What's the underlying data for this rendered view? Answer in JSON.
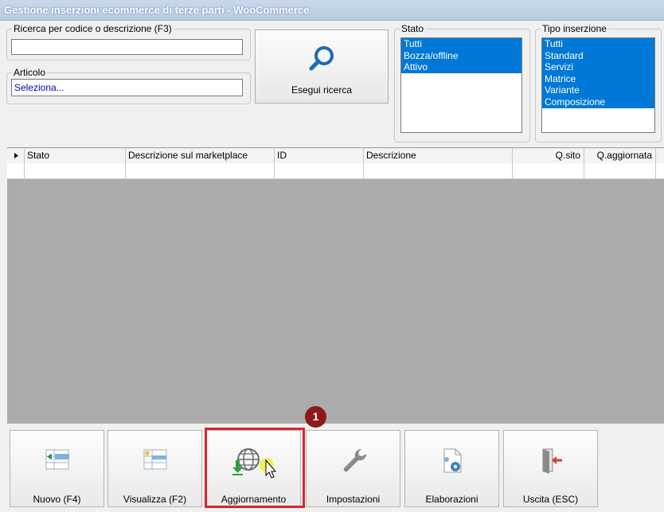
{
  "window": {
    "title": "Gestione inserzioni ecommerce di terze parti - WooCommerce"
  },
  "search": {
    "legend": "Ricerca per codice o descrizione (F3)",
    "value": ""
  },
  "articolo": {
    "legend": "Articolo",
    "value": "Seleziona..."
  },
  "search_button": {
    "label": "Esegui ricerca",
    "icon": "magnifier-icon"
  },
  "stato": {
    "legend": "Stato",
    "items": [
      "Tutti",
      "Bozza/offline",
      "Attivo"
    ]
  },
  "tipo": {
    "legend": "Tipo inserzione",
    "items": [
      "Tutti",
      "Standard",
      "Servizi",
      "Matrice",
      "Variante",
      "Composizione"
    ]
  },
  "grid": {
    "columns": [
      "Stato",
      "Descrizione sul marketplace",
      "ID",
      "Descrizione",
      "Q.sito",
      "Q.aggiornata"
    ]
  },
  "toolbar": {
    "nuovo": "Nuovo (F4)",
    "visualizza": "Visualizza (F2)",
    "aggiornamento": "Aggiornamento",
    "impostazioni": "Impostazioni",
    "elaborazioni": "Elaborazioni",
    "uscita": "Uscita (ESC)"
  },
  "annotation": {
    "step": "1",
    "color": "#d7262f"
  },
  "colors": {
    "selection": "#0078d7",
    "grid_bg": "#ababab",
    "title": "#b7cbe3"
  }
}
